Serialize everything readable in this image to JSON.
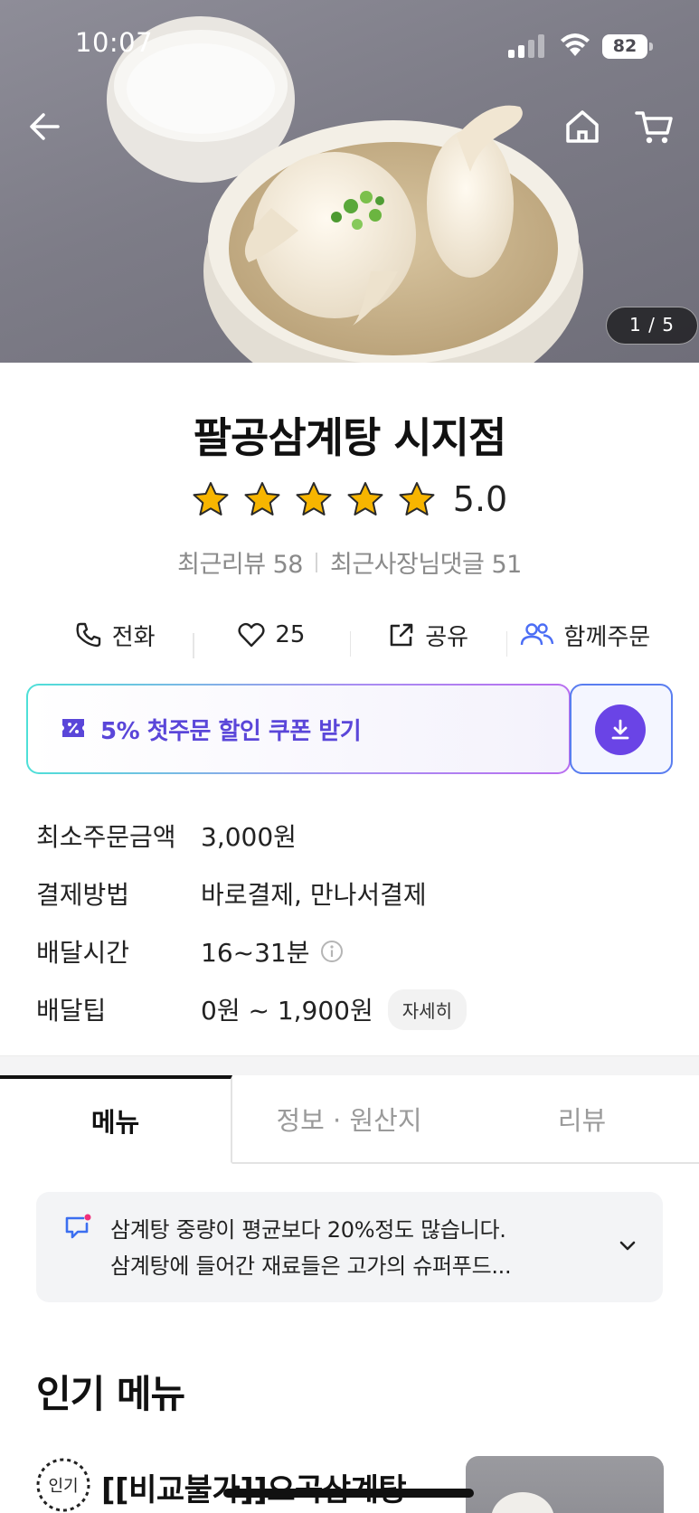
{
  "status_bar": {
    "time": "10:07",
    "battery": "82"
  },
  "hero": {
    "page_indicator": "1 / 5"
  },
  "store": {
    "name": "팔공삼계탕 시지점",
    "rating": "5.0",
    "recent_reviews": "최근리뷰 58",
    "owner_replies": "최근사장님댓글 51"
  },
  "actions": {
    "call": "전화",
    "like_count": "25",
    "share": "공유",
    "group_order": "함께주문"
  },
  "coupon": {
    "label": "5% 첫주문 할인 쿠폰 받기"
  },
  "info": {
    "rows": [
      {
        "key": "최소주문금액",
        "value": "3,000원"
      },
      {
        "key": "결제방법",
        "value": "바로결제, 만나서결제"
      },
      {
        "key": "배달시간",
        "value": "16~31분"
      },
      {
        "key": "배달팁",
        "value": "0원 ~ 1,900원"
      }
    ],
    "detail_button": "자세히"
  },
  "tabs": [
    "메뉴",
    "정보 · 원산지",
    "리뷰"
  ],
  "notice": {
    "line1": "삼계탕 중량이 평균보다 20%정도 많습니다.",
    "line2": "삼계탕에 들어간 재료들은 고가의 슈퍼푸드..."
  },
  "popular": {
    "title": "인기 메뉴",
    "badge": "인기",
    "first_item": "[[비교불가]]오곡삼계탕"
  },
  "colors": {
    "accent": "#6a44e6",
    "coupon_text": "#5a46d9",
    "star": "#f7b500"
  }
}
